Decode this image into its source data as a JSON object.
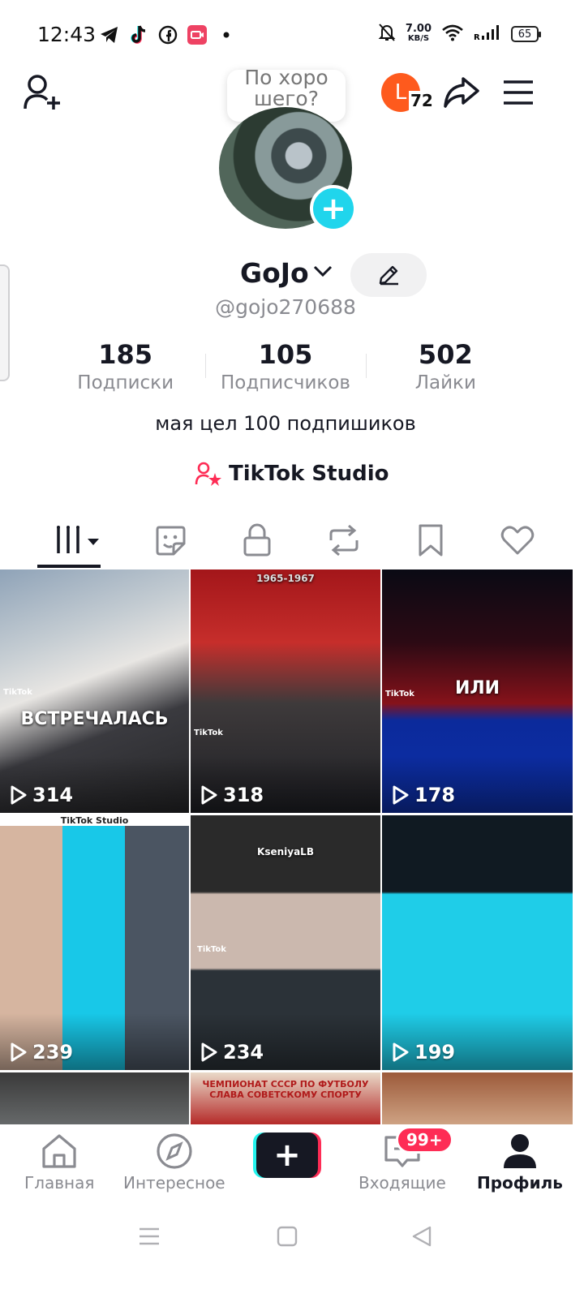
{
  "status_bar": {
    "time": "12:43",
    "net_speed_value": "7.00",
    "net_speed_unit": "KB/S",
    "battery": "65",
    "icons": [
      "telegram-icon",
      "tiktok-icon",
      "facebook-icon",
      "screen-recorder-icon",
      "dot-icon",
      "mute-icon",
      "wifi-icon",
      "signal-icon",
      "battery-icon"
    ]
  },
  "header": {
    "bubble_line1": "По хоро",
    "bubble_line2": "шего?",
    "story_letter": "L",
    "story_count": "72"
  },
  "profile": {
    "display_name": "GoJo",
    "username": "@gojo270688",
    "bio": "мая цел 100 подпишиков",
    "studio_label": "TikTok Studio",
    "stats": [
      {
        "value": "185",
        "label": "Подписки"
      },
      {
        "value": "105",
        "label": "Подписчиков"
      },
      {
        "value": "502",
        "label": "Лайки"
      }
    ]
  },
  "tabs": [
    {
      "name": "videos",
      "icon": "grid-bars-icon",
      "active": true
    },
    {
      "name": "stickers",
      "icon": "sticker-icon"
    },
    {
      "name": "private",
      "icon": "lock-icon"
    },
    {
      "name": "reposts",
      "icon": "repost-icon"
    },
    {
      "name": "favorites",
      "icon": "bookmark-icon"
    },
    {
      "name": "liked",
      "icon": "heart-icon"
    }
  ],
  "videos": [
    {
      "views": "314",
      "overlay_text": "ВСТРЕЧАЛАСЬ",
      "watermark": "TikTok"
    },
    {
      "views": "318",
      "overlay_text": "1965-1967",
      "watermark": "TikTok"
    },
    {
      "views": "178",
      "overlay_text": "ИЛИ",
      "watermark": "TikTok"
    },
    {
      "views": "239",
      "overlay_text": "TikTok Studio",
      "watermark": ""
    },
    {
      "views": "234",
      "overlay_text": "KseniyaLB",
      "watermark": "TikTok"
    },
    {
      "views": "199",
      "overlay_text": "",
      "watermark": ""
    },
    {
      "views": "",
      "overlay_text": "",
      "watermark": ""
    },
    {
      "views": "",
      "overlay_text": "ЧЕМПИОНАТ СССР ПО ФУТБОЛУ СЛАВА СОВЕТСКОМУ СПОРТУ",
      "watermark": ""
    },
    {
      "views": "",
      "overlay_text": "",
      "watermark": ""
    }
  ],
  "bottom_nav": {
    "home": "Главная",
    "discover": "Интересное",
    "inbox": "Входящие",
    "profile": "Профиль",
    "inbox_badge": "99+"
  },
  "colors": {
    "accent_pink": "#fe2c55",
    "accent_cyan": "#25f4ee",
    "plus_blue": "#20d5ec",
    "text_primary": "#161823",
    "text_secondary": "#8a8b91"
  }
}
